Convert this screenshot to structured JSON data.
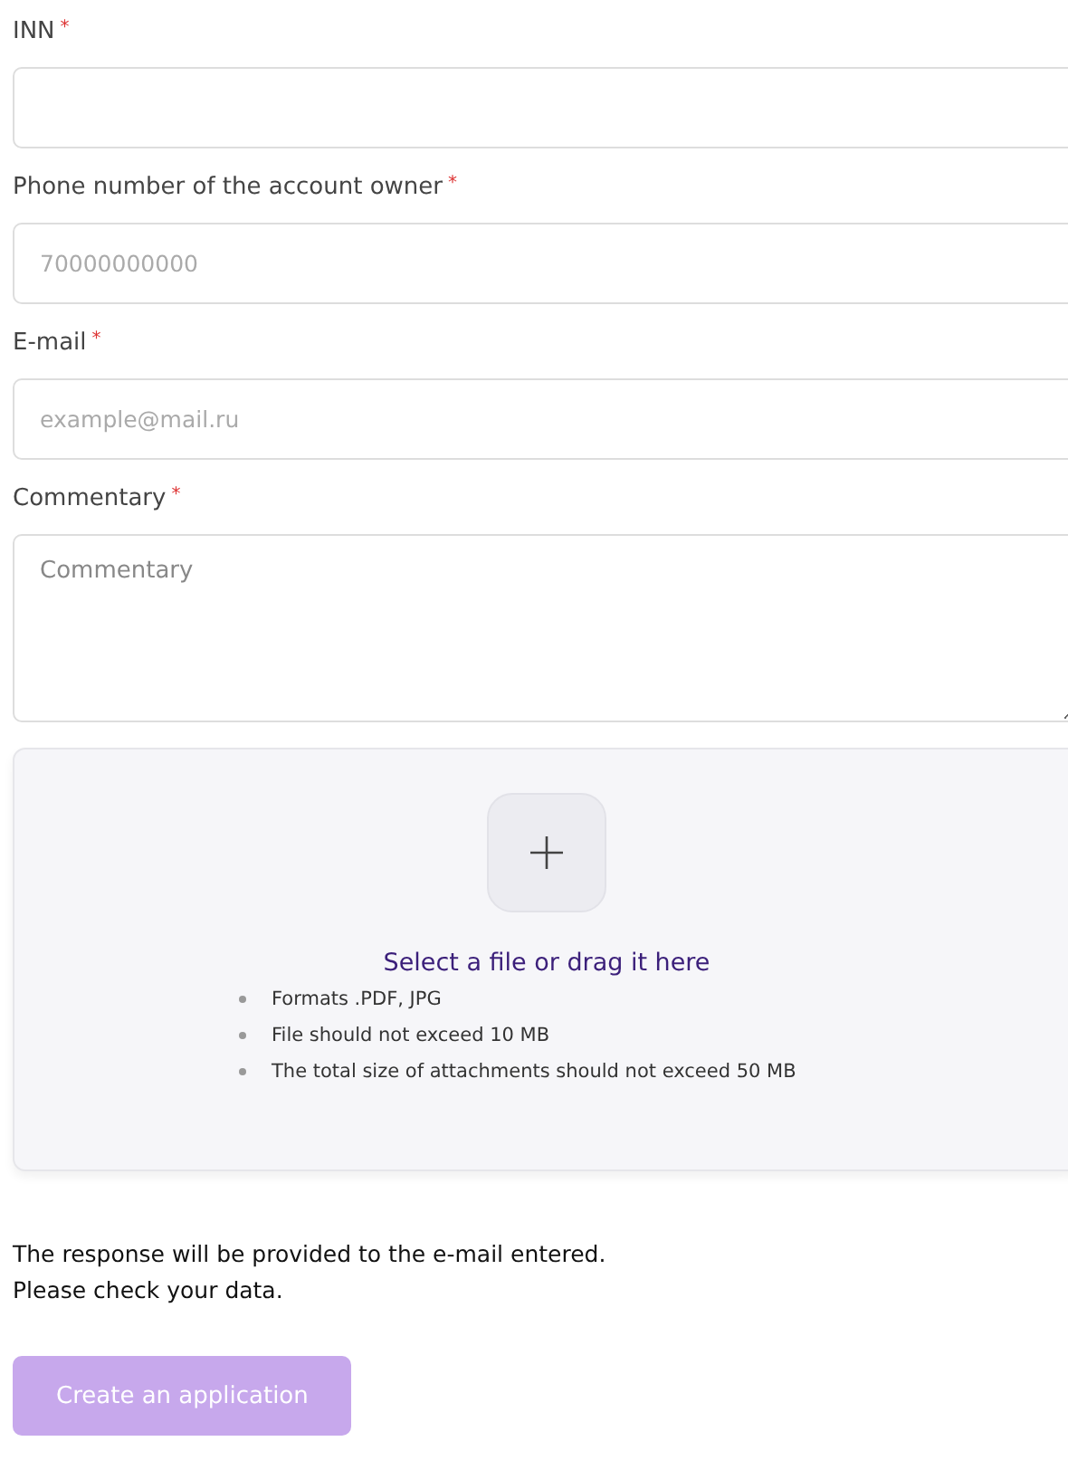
{
  "fields": [
    {
      "kind": "input",
      "label": "INN",
      "required_mark": "*"
    },
    {
      "kind": "input",
      "label": "Phone number of the account owner",
      "required_mark": "*",
      "placeholder": "70000000000"
    },
    {
      "kind": "input",
      "label": "E-mail",
      "required_mark": "*",
      "placeholder": "example@mail.ru"
    },
    {
      "kind": "textarea",
      "label": "Commentary",
      "required_mark": "*",
      "placeholder": "Commentary"
    }
  ],
  "upload": {
    "title": "Select a file or drag it here",
    "rules": [
      "Formats .PDF, JPG",
      "File should not exceed 10 MB",
      "The total size of attachments should not exceed 50 MB"
    ]
  },
  "note": [
    "The response will be provided to the e-mail entered.",
    "Please check your data."
  ],
  "submit": {
    "label": "Create an application",
    "disabled": true
  }
}
